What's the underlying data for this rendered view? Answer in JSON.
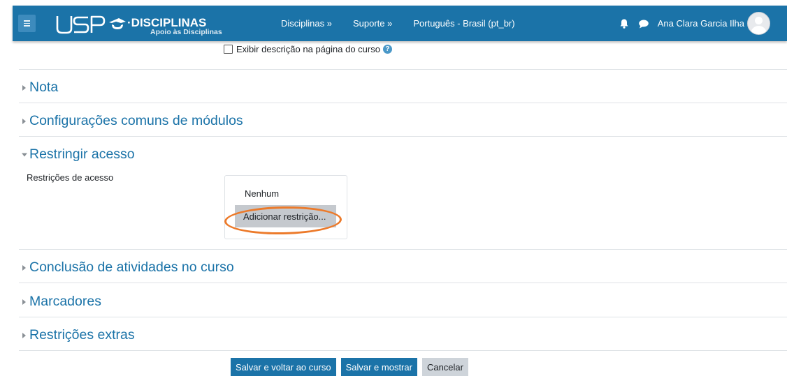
{
  "navbar": {
    "logo_text": "USP",
    "logo_title": "·DISCIPLINAS",
    "logo_subtitle": "Apoio às Disciplinas",
    "menu": [
      "Disciplinas »",
      "Suporte »",
      "Português - Brasil (pt_br)"
    ],
    "user_name": "Ana Clara Garcia Ilha",
    "bar_color": "#1b73a8"
  },
  "form": {
    "show_description_label": "Exibir descrição na página do curso",
    "show_description_checked": false,
    "help_icon": "?"
  },
  "sections": [
    {
      "title": "Nota",
      "expanded": false
    },
    {
      "title": "Configurações comuns de módulos",
      "expanded": false
    },
    {
      "title": "Restringir acesso",
      "expanded": true
    },
    {
      "title": "Conclusão de atividades no curso",
      "expanded": false
    },
    {
      "title": "Marcadores",
      "expanded": false
    },
    {
      "title": "Restrições extras",
      "expanded": false
    }
  ],
  "restrict": {
    "label": "Restrições de acesso",
    "none_text": "Nenhum",
    "add_button": "Adicionar restrição..."
  },
  "buttons": {
    "save_return": "Salvar e voltar ao curso",
    "save_display": "Salvar e mostrar",
    "cancel": "Cancelar"
  },
  "colors": {
    "accent": "#1b73a8",
    "highlight_ring": "#ec7a2a"
  }
}
